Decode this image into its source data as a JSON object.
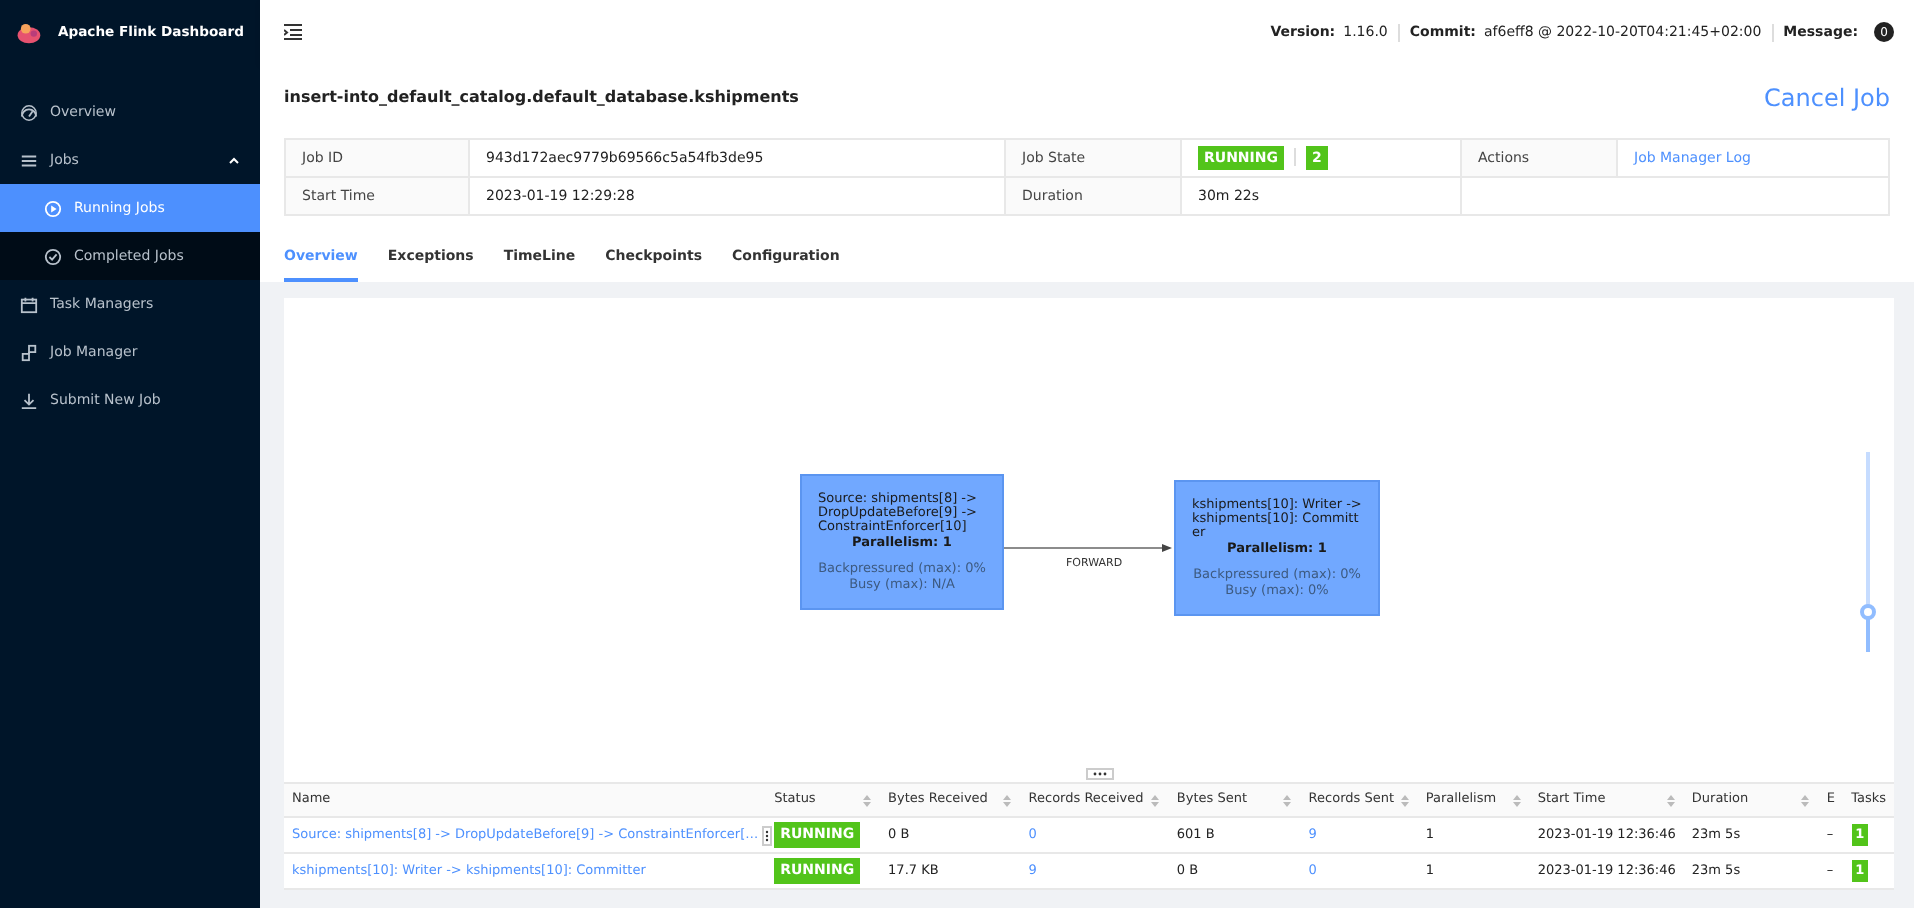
{
  "sidebar": {
    "title": "Apache Flink Dashboard",
    "items": [
      {
        "kind": "link",
        "label": "Overview",
        "selected": false
      },
      {
        "kind": "group",
        "label": "Jobs",
        "expanded": true,
        "children": [
          {
            "label": "Running Jobs",
            "selected": true
          },
          {
            "label": "Completed Jobs",
            "selected": false
          }
        ]
      },
      {
        "kind": "link",
        "label": "Task Managers",
        "selected": false
      },
      {
        "kind": "link",
        "label": "Job Manager",
        "selected": false
      },
      {
        "kind": "link",
        "label": "Submit New Job",
        "selected": false
      }
    ]
  },
  "header": {
    "items": [
      {
        "label": "Version:",
        "value": "1.16.0"
      },
      {
        "label": "Commit:",
        "value": "af6eff8 @ 2022-10-20T04:21:45+02:00"
      }
    ],
    "message": {
      "label": "Message:",
      "count": "0"
    }
  },
  "job": {
    "title": "insert-into_default_catalog.default_database.kshipments",
    "cancel": "Cancel Job",
    "info": [
      [
        {
          "label": "Job ID",
          "kind": "text",
          "value": "943d172aec9779b69566c5a54fb3de95"
        },
        {
          "label": "Job State",
          "kind": "state",
          "value": "RUNNING",
          "count": "2"
        },
        {
          "label": "Actions",
          "kind": "link",
          "value": "Job Manager Log"
        }
      ],
      [
        {
          "label": "Start Time",
          "kind": "text",
          "value": "2023-01-19 12:29:28"
        },
        {
          "label": "Duration",
          "kind": "text",
          "value": "30m 22s"
        }
      ]
    ]
  },
  "tabs": [
    {
      "label": "Overview",
      "selected": true
    },
    {
      "label": "Exceptions",
      "selected": false
    },
    {
      "label": "TimeLine",
      "selected": false
    },
    {
      "label": "Checkpoints",
      "selected": false
    },
    {
      "label": "Configuration",
      "selected": false
    }
  ],
  "graph": {
    "nodes": [
      {
        "title": "Source: shipments[8] -> DropUpdateBefore[9] -> ConstraintEnforcer[10]",
        "parallelism": "Parallelism: 1",
        "backpressured": "Backpressured (max): 0%",
        "busy": "Busy (max): N/A"
      },
      {
        "title": "kshipments[10]: Writer -> kshipments[10]: Committer",
        "parallelism": "Parallelism: 1",
        "backpressured": "Backpressured (max): 0%",
        "busy": "Busy (max): 0%"
      }
    ],
    "edges": [
      {
        "label": "FORWARD"
      }
    ],
    "zoom": {
      "level": 0.2
    }
  },
  "vertices": {
    "columns": [
      {
        "label": "Name",
        "sortable": false
      },
      {
        "label": "Status",
        "sortable": true
      },
      {
        "label": "Bytes Received",
        "sortable": true
      },
      {
        "label": "Records Received",
        "sortable": true
      },
      {
        "label": "Bytes Sent",
        "sortable": true
      },
      {
        "label": "Records Sent",
        "sortable": true
      },
      {
        "label": "Parallelism",
        "sortable": true
      },
      {
        "label": "Start Time",
        "sortable": true
      },
      {
        "label": "Duration",
        "sortable": true
      },
      {
        "label": "E",
        "sortable": false
      },
      {
        "label": "Tasks",
        "sortable": false
      }
    ],
    "rows": [
      {
        "name": "Source: shipments[8] -> DropUpdateBefore[9] -> ConstraintEnforcer[…",
        "status": "RUNNING",
        "bytes_received": "0 B",
        "records_received": "0",
        "bytes_sent": "601 B",
        "records_sent": "9",
        "parallelism": "1",
        "start_time": "2023-01-19 12:36:46",
        "duration": "23m 5s",
        "column_10": "–",
        "tasks": "1"
      },
      {
        "name": "kshipments[10]: Writer -> kshipments[10]: Committer",
        "status": "RUNNING",
        "bytes_received": "17.7 KB",
        "records_received": "9",
        "bytes_sent": "0 B",
        "records_sent": "0",
        "parallelism": "1",
        "start_time": "2023-01-19 12:36:46",
        "duration": "23m 5s",
        "column_10": "–",
        "tasks": "1"
      }
    ]
  }
}
